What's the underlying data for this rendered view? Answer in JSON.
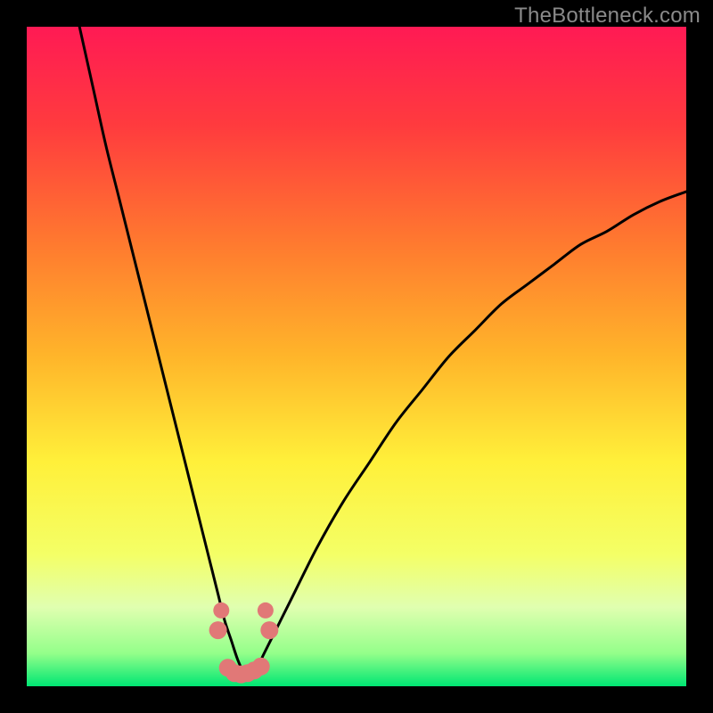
{
  "watermark": "TheBottleneck.com",
  "colors": {
    "page_bg": "#000000",
    "watermark_text": "#8a8a8a",
    "curve": "#000000",
    "marker": "#e17877",
    "gradient_stops": [
      {
        "offset": 0.0,
        "color": "#ff1a54"
      },
      {
        "offset": 0.15,
        "color": "#ff3b3e"
      },
      {
        "offset": 0.33,
        "color": "#ff7a2f"
      },
      {
        "offset": 0.5,
        "color": "#ffb52a"
      },
      {
        "offset": 0.66,
        "color": "#fff03a"
      },
      {
        "offset": 0.8,
        "color": "#f4ff66"
      },
      {
        "offset": 0.88,
        "color": "#e0ffb0"
      },
      {
        "offset": 0.95,
        "color": "#94ff8a"
      },
      {
        "offset": 1.0,
        "color": "#00e673"
      }
    ]
  },
  "chart_data": {
    "type": "line",
    "title": "",
    "xlabel": "",
    "ylabel": "",
    "xlim": [
      0,
      100
    ],
    "ylim": [
      0,
      100
    ],
    "series": [
      {
        "name": "bottleneck-curve",
        "x": [
          8,
          10,
          12,
          14,
          16,
          18,
          20,
          22,
          24,
          26,
          28,
          29,
          30,
          31,
          32,
          33,
          34,
          35,
          36,
          38,
          40,
          44,
          48,
          52,
          56,
          60,
          64,
          68,
          72,
          76,
          80,
          84,
          88,
          92,
          96,
          100
        ],
        "values": [
          100,
          91,
          82,
          74,
          66,
          58,
          50,
          42,
          34,
          26,
          18,
          14,
          10,
          7,
          4,
          2,
          2,
          3,
          5,
          9,
          13,
          21,
          28,
          34,
          40,
          45,
          50,
          54,
          58,
          61,
          64,
          67,
          69,
          71.5,
          73.5,
          75
        ]
      }
    ],
    "markers": {
      "name": "highlight-dots",
      "x": [
        29.0,
        30.5,
        31.5,
        32.5,
        33.5,
        34.5,
        35.5,
        36.8,
        29.5,
        36.2
      ],
      "y": [
        8.5,
        2.8,
        2.0,
        1.8,
        2.0,
        2.4,
        3.0,
        8.5,
        11.5,
        11.5
      ],
      "r": [
        10,
        10,
        10,
        10,
        10,
        10,
        10,
        10,
        9,
        9
      ]
    }
  }
}
